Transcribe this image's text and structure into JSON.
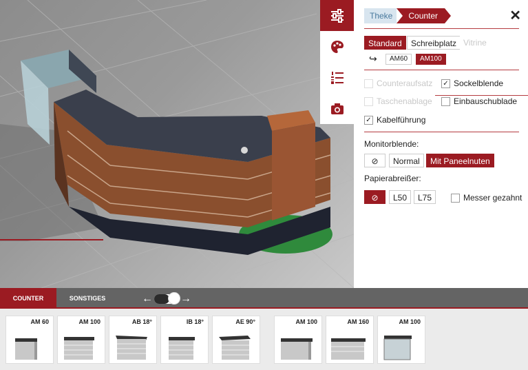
{
  "toolbar": {
    "icons": [
      "sliders-icon",
      "palette-icon",
      "list-numbered-icon",
      "camera-icon"
    ]
  },
  "panel": {
    "breadcrumb": [
      "Theke",
      "Counter"
    ],
    "close_label": "✕",
    "type_options": [
      "Standard",
      "Schreibplatz",
      "Vitrine"
    ],
    "size_arrow": "↪",
    "size_options": [
      "AM60",
      "AM100"
    ],
    "checks": {
      "counteraufsatz": "Counteraufsatz",
      "sockelblende": "Sockelblende",
      "taschenablage": "Taschenablage",
      "einbauschublade": "Einbauschublade",
      "kabelfuehrung": "Kabelführung"
    },
    "monitor_label": "Monitorblende:",
    "monitor_options": [
      "⊘",
      "Normal",
      "Mit Paneelnuten"
    ],
    "paper_label": "Papierabreißer:",
    "paper_options": [
      "⊘",
      "L50",
      "L75"
    ],
    "messer_label": "Messer gezahnt",
    "check_mark": "✓"
  },
  "categories": {
    "tabs": [
      "COUNTER",
      "SONSTIGES"
    ],
    "left_arrow": "←",
    "right_arrow": "→"
  },
  "items": [
    "AM 60",
    "AM 100",
    "AB 18°",
    "IB 18°",
    "AE 90°",
    "AM 100",
    "AM 160",
    "AM 100"
  ],
  "colors": {
    "accent": "#9b1b22",
    "breadcrumb_bg": "#d8e5ef"
  }
}
